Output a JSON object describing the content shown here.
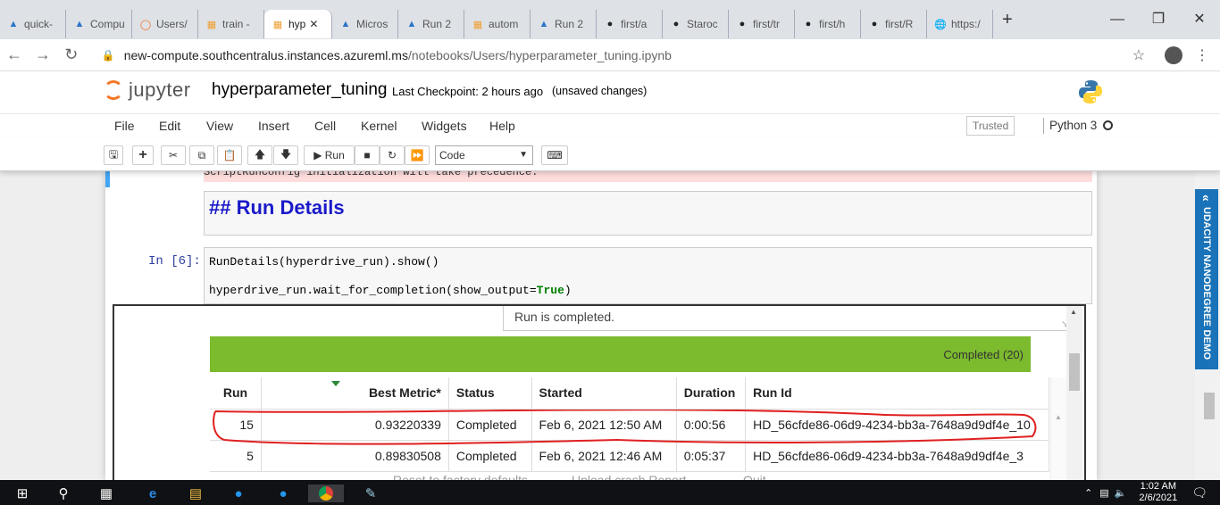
{
  "browser": {
    "tabs": [
      {
        "label": "quick-",
        "icon": "azure-ml-icon"
      },
      {
        "label": "Compu",
        "icon": "azure-ml-icon"
      },
      {
        "label": "Users/",
        "icon": "jupyter-icon"
      },
      {
        "label": "train -",
        "icon": "notebook-icon"
      },
      {
        "label": "hyp",
        "icon": "notebook-icon",
        "active": true
      },
      {
        "label": "Micros",
        "icon": "azure-ml-icon"
      },
      {
        "label": "Run 2",
        "icon": "azure-ml-icon"
      },
      {
        "label": "autom",
        "icon": "notebook-icon"
      },
      {
        "label": "Run 2",
        "icon": "azure-ml-icon"
      },
      {
        "label": "first/a",
        "icon": "github-icon"
      },
      {
        "label": "Staroc",
        "icon": "github-icon"
      },
      {
        "label": "first/tr",
        "icon": "github-icon"
      },
      {
        "label": "first/h",
        "icon": "github-icon"
      },
      {
        "label": "first/R",
        "icon": "github-icon"
      },
      {
        "label": "https:/",
        "icon": "globe-icon"
      }
    ],
    "url_host": "new-compute.southcentralus.instances.azureml.ms",
    "url_path": "/notebooks/Users/hyperparameter_tuning.ipynb"
  },
  "jupyter": {
    "logo_text": "jupyter",
    "notebook_name": "hyperparameter_tuning",
    "checkpoint": "Last Checkpoint: 2 hours ago",
    "unsaved": "(unsaved changes)",
    "menu": [
      "File",
      "Edit",
      "View",
      "Insert",
      "Cell",
      "Kernel",
      "Widgets",
      "Help"
    ],
    "trusted": "Trusted",
    "kernel": "Python 3",
    "run_label": "Run",
    "cell_type": "Code"
  },
  "cells": {
    "error_text": "ScriptRunConfig initialization will take precedence.",
    "markdown_heading": "## Run Details",
    "prompt": "In [6]:",
    "code_line1": "RunDetails(hyperdrive_run).show()",
    "code_line2_pre": "hyperdrive_run.wait_for_completion(show_output=",
    "code_line2_kw": "True",
    "code_line2_post": ")"
  },
  "widget": {
    "status": "Run is completed.",
    "completed_label": "Completed (20)",
    "columns": [
      "Run",
      "Best Metric*",
      "Status",
      "Started",
      "Duration",
      "Run Id"
    ],
    "rows": [
      {
        "run": "15",
        "metric": "0.93220339",
        "status": "Completed",
        "started": "Feb 6, 2021 12:50 AM",
        "duration": "0:00:56",
        "run_id": "HD_56cfde86-06d9-4234-bb3a-7648a9d9df4e_10"
      },
      {
        "run": "5",
        "metric": "0.89830508",
        "status": "Completed",
        "started": "Feb 6, 2021 12:46 AM",
        "duration": "0:05:37",
        "run_id": "HD_56cfde86-06d9-4234-bb3a-7648a9d9df4e_3"
      }
    ]
  },
  "extension": {
    "label": "UDACITY NANODEGREE DEMO"
  },
  "ghost": {
    "a": "Reset to factory defaults",
    "b": "Upload crash Report",
    "c": "Quit"
  },
  "taskbar": {
    "time": "1:02 AM",
    "date": "2/6/2021"
  },
  "colors": {
    "green_bar": "#7cba2e",
    "annotation": "#e02020",
    "udacity": "#1a73b8",
    "markdown_heading": "#1a1aca"
  }
}
